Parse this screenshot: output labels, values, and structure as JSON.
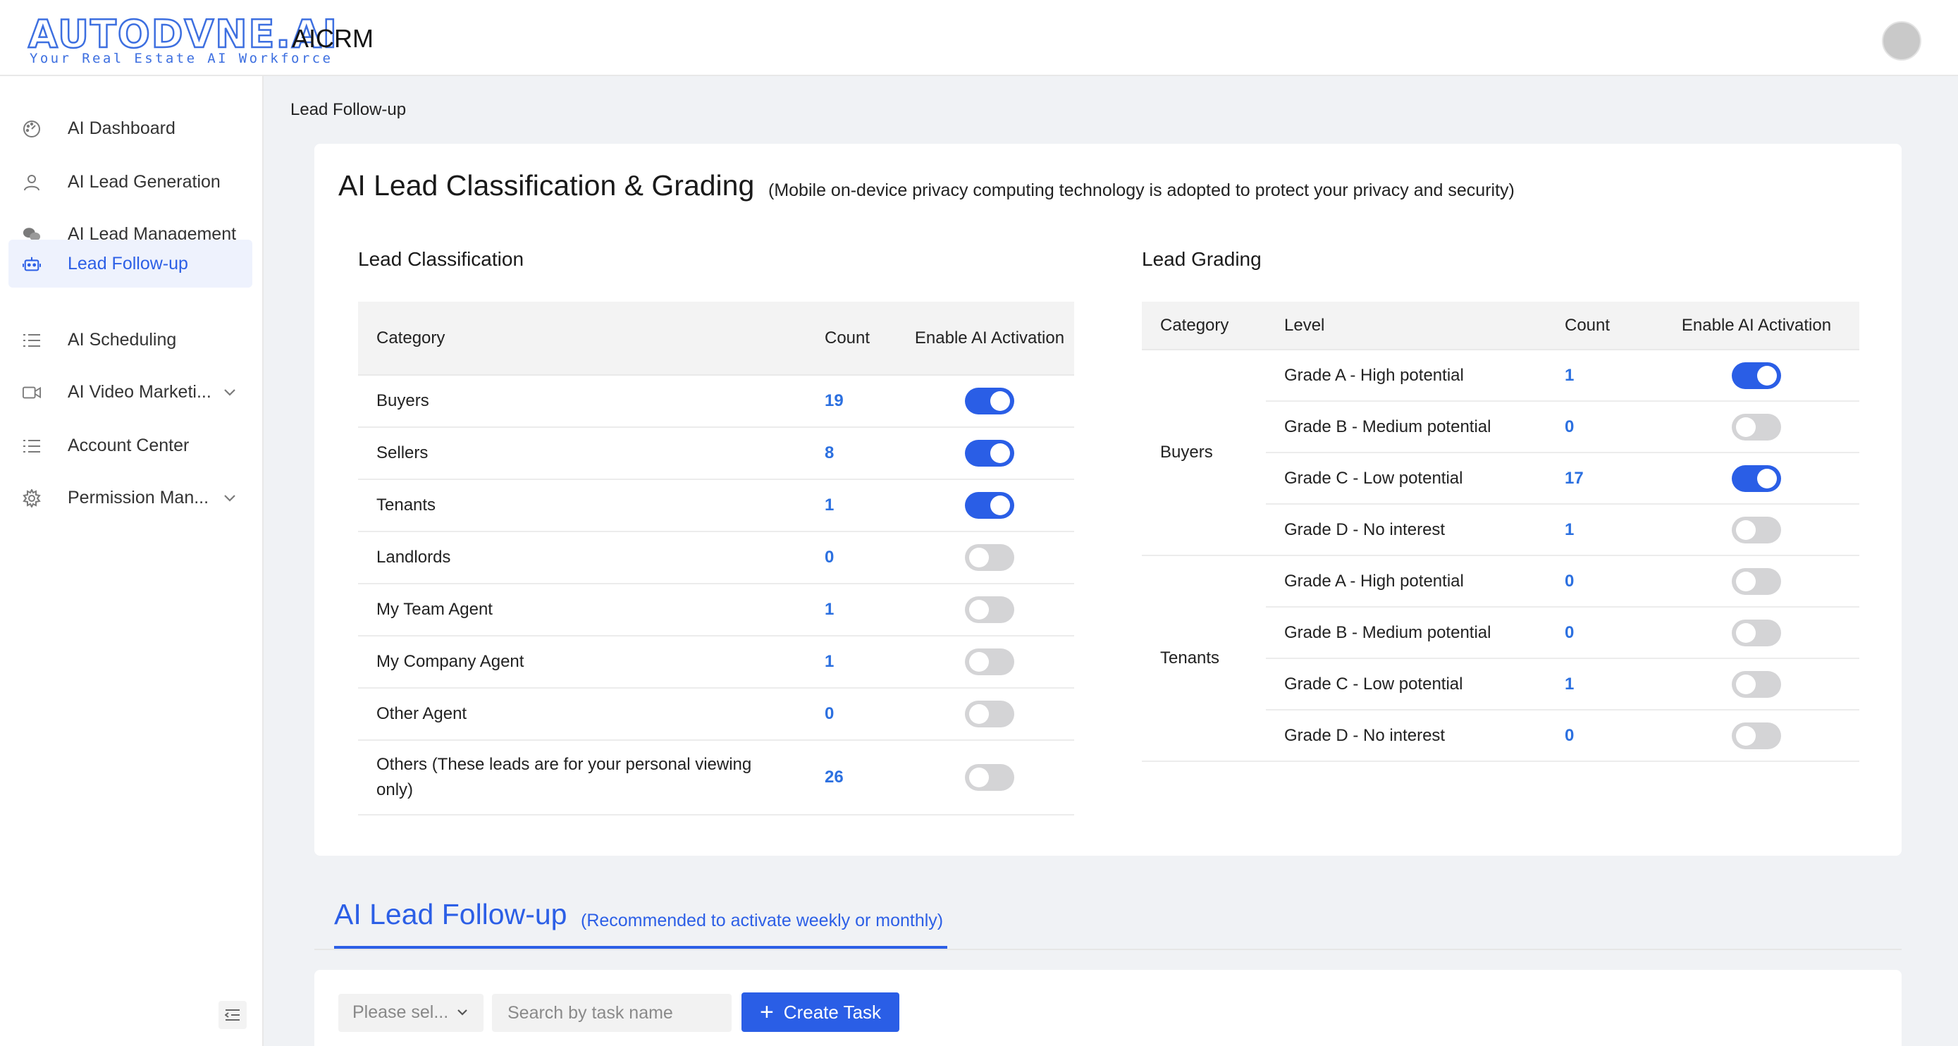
{
  "header": {
    "logo_main": "AUTODVNE.AI",
    "logo_sub": "Your Real Estate AI Workforce",
    "app_title": "AICRM"
  },
  "sidebar": {
    "items": [
      {
        "label": "AI Dashboard",
        "icon": "dashboard-icon"
      },
      {
        "label": "AI Lead Generation",
        "icon": "user-icon"
      },
      {
        "label": "AI Lead Management",
        "icon": "chat-icon"
      },
      {
        "label": "Lead Follow-up",
        "icon": "robot-icon",
        "active": true
      },
      {
        "label": "AI Scheduling",
        "icon": "list-icon"
      },
      {
        "label": "AI Video Marketi...",
        "icon": "video-icon",
        "expandable": true
      },
      {
        "label": "Account Center",
        "icon": "list-icon"
      },
      {
        "label": "Permission Man...",
        "icon": "gear-icon",
        "expandable": true
      }
    ]
  },
  "breadcrumb": "Lead Follow-up",
  "card": {
    "title": "AI Lead Classification & Grading",
    "note": "(Mobile on-device privacy computing technology is adopted to protect your privacy and security)"
  },
  "classification": {
    "title": "Lead Classification",
    "headers": {
      "category": "Category",
      "count": "Count",
      "enable": "Enable AI Activation"
    },
    "rows": [
      {
        "category": "Buyers",
        "count": "19",
        "enabled": true
      },
      {
        "category": "Sellers",
        "count": "8",
        "enabled": true
      },
      {
        "category": "Tenants",
        "count": "1",
        "enabled": true
      },
      {
        "category": "Landlords",
        "count": "0",
        "enabled": false
      },
      {
        "category": "My Team Agent",
        "count": "1",
        "enabled": false
      },
      {
        "category": "My Company Agent",
        "count": "1",
        "enabled": false
      },
      {
        "category": "Other Agent",
        "count": "0",
        "enabled": false
      },
      {
        "category": "Others (These leads are for your personal viewing only)",
        "count": "26",
        "enabled": false
      }
    ]
  },
  "grading": {
    "title": "Lead Grading",
    "headers": {
      "category": "Category",
      "level": "Level",
      "count": "Count",
      "enable": "Enable AI Activation"
    },
    "groups": [
      {
        "category": "Buyers",
        "rows": [
          {
            "level": "Grade A - High potential",
            "count": "1",
            "enabled": true
          },
          {
            "level": "Grade B - Medium potential",
            "count": "0",
            "enabled": false
          },
          {
            "level": "Grade C - Low potential",
            "count": "17",
            "enabled": true
          },
          {
            "level": "Grade D - No interest",
            "count": "1",
            "enabled": false
          }
        ]
      },
      {
        "category": "Tenants",
        "rows": [
          {
            "level": "Grade A - High potential",
            "count": "0",
            "enabled": false
          },
          {
            "level": "Grade B - Medium potential",
            "count": "0",
            "enabled": false
          },
          {
            "level": "Grade C - Low potential",
            "count": "1",
            "enabled": false
          },
          {
            "level": "Grade D - No interest",
            "count": "0",
            "enabled": false
          }
        ]
      }
    ]
  },
  "follow_up": {
    "title": "AI Lead Follow-up",
    "note": "(Recommended to activate weekly or monthly)",
    "select_placeholder": "Please sel...",
    "search_placeholder": "Search by task name",
    "create_label": "Create Task"
  },
  "colors": {
    "accent": "#2a5ee6",
    "count": "#2c70e0",
    "toggle_off": "#d4d4d6"
  }
}
